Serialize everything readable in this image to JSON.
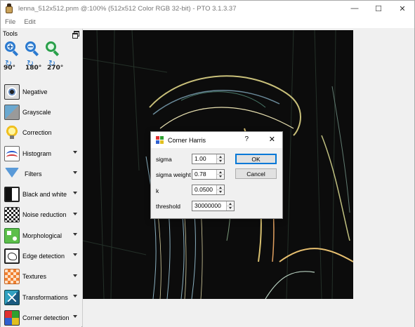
{
  "window": {
    "title": "lenna_512x512.pnm @:100% (512x512 Color RGB 32-bit) - PTO 3.1.3.37",
    "controls": {
      "minimize": "—",
      "maximize": "☐",
      "close": "✕"
    }
  },
  "menu": {
    "items": [
      "File",
      "Edit"
    ]
  },
  "tools": {
    "header": "Tools",
    "zoom": [
      "zoom-in-icon",
      "zoom-out-icon",
      "zoom-fit-icon"
    ],
    "rotate": [
      "90°",
      "180°",
      "270°"
    ],
    "items": [
      {
        "label": "Negative",
        "icon": "eye-icon",
        "has_menu": false
      },
      {
        "label": "Grayscale",
        "icon": "grayscale-icon",
        "has_menu": false
      },
      {
        "label": "Correction",
        "icon": "lightbulb-icon",
        "has_menu": false
      },
      {
        "label": "Histogram",
        "icon": "histogram-icon",
        "has_menu": true
      },
      {
        "label": "Filters",
        "icon": "funnel-icon",
        "has_menu": true
      },
      {
        "label": "Black and white",
        "icon": "yin-yang-icon",
        "has_menu": true
      },
      {
        "label": "Noise reduction",
        "icon": "checkerboard-icon",
        "has_menu": true
      },
      {
        "label": "Morphological",
        "icon": "shapes-icon",
        "has_menu": true
      },
      {
        "label": "Edge detection",
        "icon": "edge-icon",
        "has_menu": true
      },
      {
        "label": "Textures",
        "icon": "texture-icon",
        "has_menu": true
      },
      {
        "label": "Transformations",
        "icon": "transform-icon",
        "has_menu": true
      },
      {
        "label": "Corner detection",
        "icon": "corner-icon",
        "has_menu": true
      }
    ]
  },
  "dialog": {
    "title": "Corner Harris",
    "help": "?",
    "close": "✕",
    "fields": [
      {
        "label": "sigma",
        "value": "1.00"
      },
      {
        "label": "sigma weight",
        "value": "0.78"
      },
      {
        "label": "k",
        "value": "0.0500"
      },
      {
        "label": "threshold",
        "value": "30000000"
      }
    ],
    "ok_label": "OK",
    "cancel_label": "Cancel"
  }
}
